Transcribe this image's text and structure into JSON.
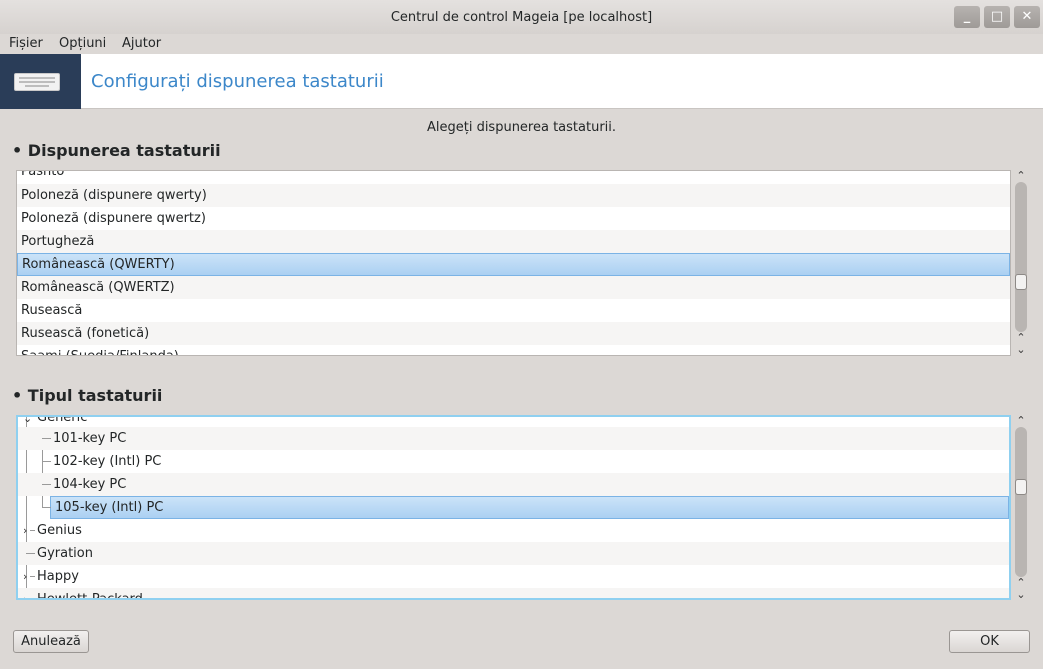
{
  "window": {
    "title": "Centrul de control Mageia  [pe localhost]",
    "minimize_glyph": "_",
    "maximize_glyph": "□",
    "close_glyph": "✕"
  },
  "menu": {
    "file": "Fișier",
    "options": "Opțiuni",
    "help": "Ajutor"
  },
  "banner": {
    "title": "Configurați dispunerea tastaturii",
    "icon": "keyboard-icon",
    "icon_bg": "#2a3d58",
    "title_color": "#3c87c9"
  },
  "prompt": "Alegeți dispunerea tastaturii.",
  "layout_section": {
    "title": "• Dispunerea tastaturii",
    "items": [
      "Pashto",
      "Poloneză (dispunere qwerty)",
      "Poloneză (dispunere qwertz)",
      "Portugheză",
      "Românească (QWERTY)",
      "Românească (QWERTZ)",
      "Rusească",
      "Rusească (fonetică)",
      "Saami (Suedia/Finlanda)"
    ],
    "selected": "Românească (QWERTY)"
  },
  "type_section": {
    "title": "• Tipul tastaturii",
    "group": "Generic",
    "children": [
      "101-key PC",
      "102-key (Intl) PC",
      "104-key PC",
      "105-key (Intl) PC"
    ],
    "others": [
      "Genius",
      "Gyration",
      "Happy",
      "Hewlett-Packard"
    ],
    "selected": "105-key (Intl) PC"
  },
  "scroll_glyphs": {
    "up": "⌃",
    "down": "⌄"
  },
  "buttons": {
    "cancel": "Anulează",
    "ok": "OK"
  },
  "colors": {
    "selection": "#abd0f2",
    "selection_border": "#7bb3e5",
    "focus_border": "#8fd0f0"
  }
}
